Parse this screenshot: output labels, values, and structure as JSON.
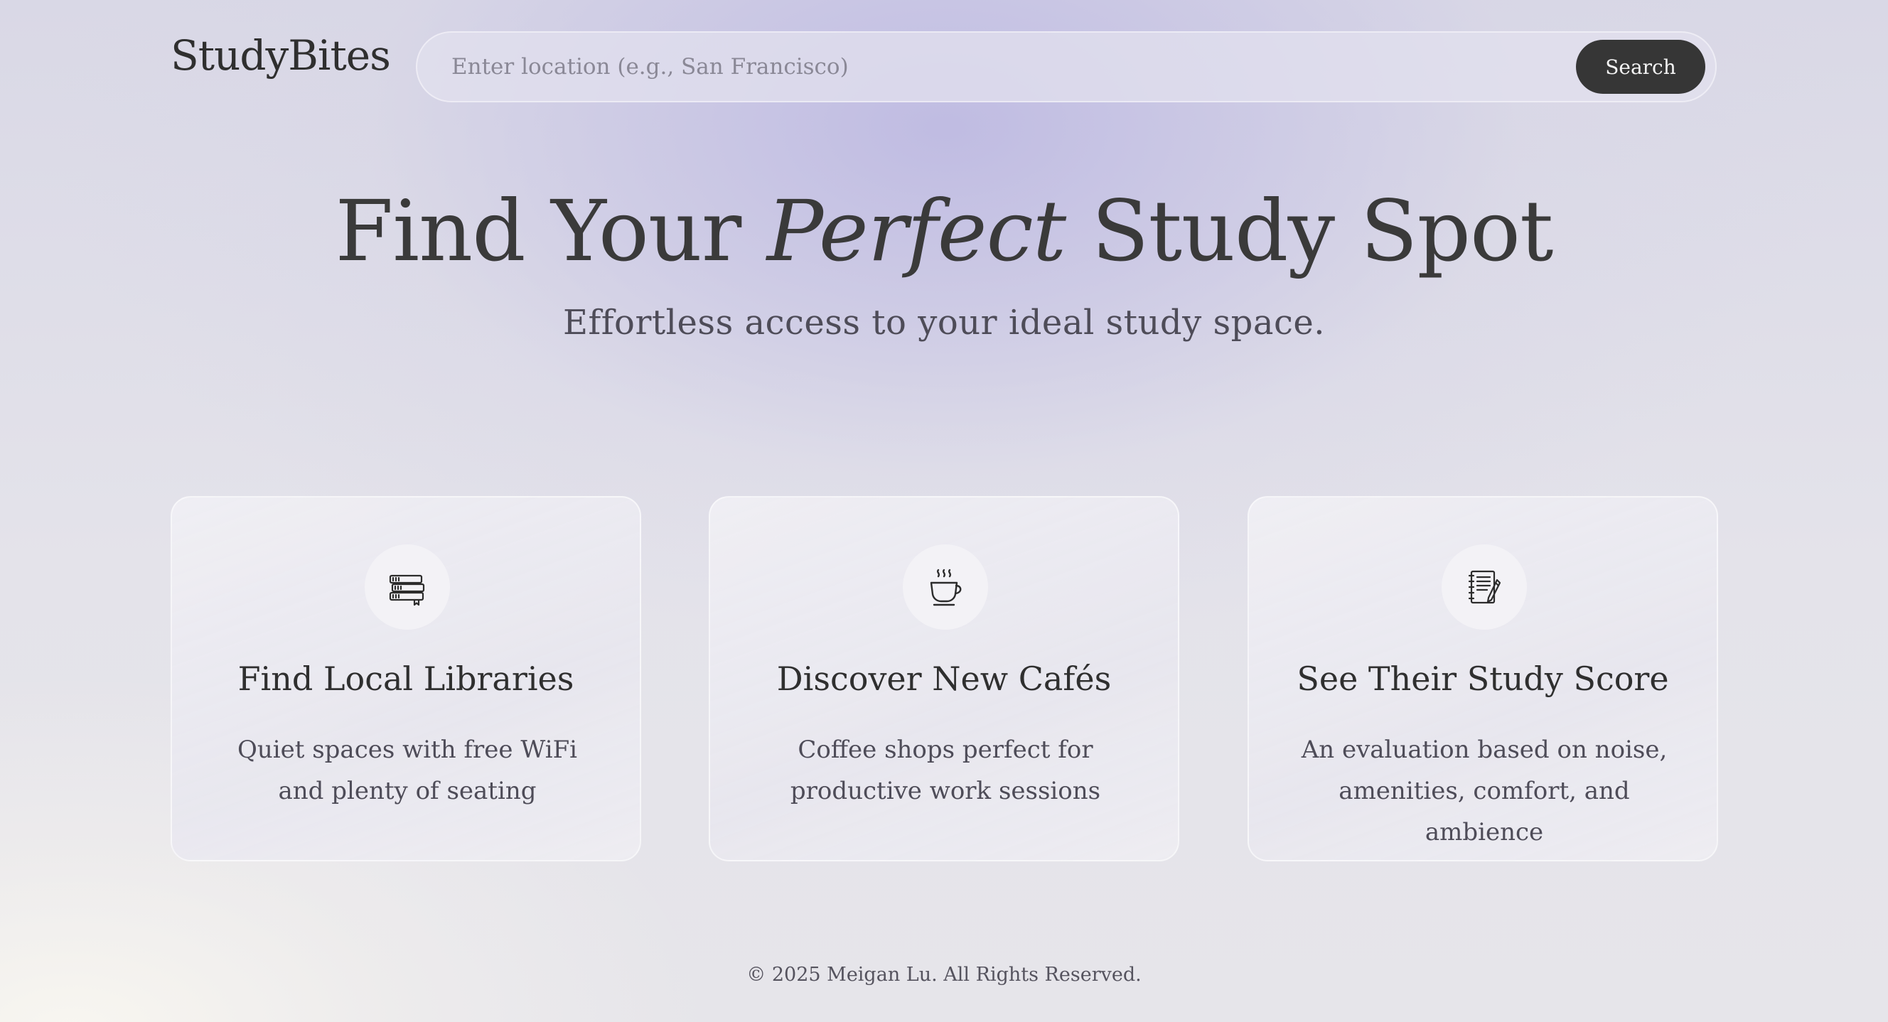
{
  "header": {
    "logo": "StudyBites",
    "search_placeholder": "Enter location (e.g., San Francisco)",
    "search_button": "Search"
  },
  "hero": {
    "title_before": "Find Your ",
    "title_emphasis": "Perfect",
    "title_after": " Study Spot",
    "subtitle": "Effortless access to your ideal study space."
  },
  "features": [
    {
      "icon": "books-icon",
      "title": "Find Local Libraries",
      "description": "Quiet spaces with free WiFi and plenty of seating"
    },
    {
      "icon": "coffee-cup-icon",
      "title": "Discover New Cafés",
      "description": "Coffee shops perfect for productive work sessions"
    },
    {
      "icon": "notepad-pencil-icon",
      "title": "See Their Study Score",
      "description": "An evaluation based on noise, amenities, comfort, and ambience"
    }
  ],
  "footer": {
    "copyright": "© 2025 Meigan Lu. All Rights Reserved."
  },
  "colors": {
    "button_bg": "#363636",
    "text_primary": "#3a3a3a",
    "accent_lavender": "#c3c0e0"
  }
}
